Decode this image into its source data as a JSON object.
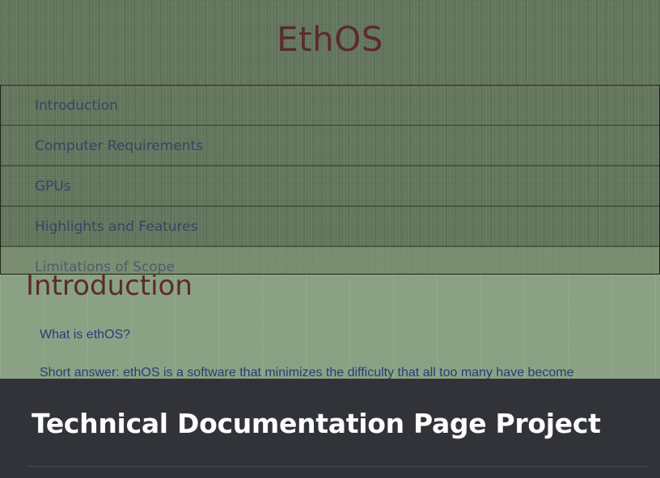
{
  "header": {
    "title": "EthOS"
  },
  "nav": {
    "items": [
      {
        "label": "Introduction"
      },
      {
        "label": "Computer Requirements"
      },
      {
        "label": "GPUs"
      },
      {
        "label": "Highlights and Features"
      },
      {
        "label": "Limitations of Scope"
      }
    ]
  },
  "main": {
    "section_title": "Introduction",
    "question": "What is ethOS?",
    "answer": "Short answer: ethOS is a software that minimizes the difficulty that all too many have become"
  },
  "panel": {
    "title": "Technical Documentation Page Project"
  }
}
